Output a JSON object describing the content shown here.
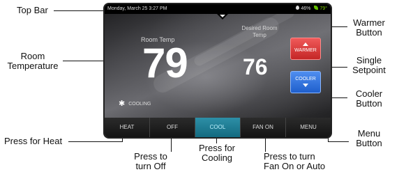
{
  "callouts": {
    "top_bar": "Top Bar",
    "room_temperature_line1": "Room",
    "room_temperature_line2": "Temperature",
    "press_for_heat": "Press for Heat",
    "press_to_turn_off_line1": "Press to",
    "press_to_turn_off_line2": "turn Off",
    "press_for_cooling_line1": "Press for",
    "press_for_cooling_line2": "Cooling",
    "press_fan_line1": "Press to turn",
    "press_fan_line2": "Fan On or Auto",
    "warmer_button_line1": "Warmer",
    "warmer_button_line2": "Button",
    "single_setpoint_line1": "Single",
    "single_setpoint_line2": "Setpoint",
    "cooler_button_line1": "Cooler",
    "cooler_button_line2": "Button",
    "menu_button_line1": "Menu",
    "menu_button_line2": "Button"
  },
  "screen": {
    "topbar": {
      "datetime": "Monday, March 25 3:27 PM",
      "humidity": "46%",
      "outdoor_temp": "79°"
    },
    "room_temp_label": "Room Temp",
    "room_temp": "79",
    "setpoint_label": "Desired Room Temp",
    "setpoint": "76",
    "warmer_label": "WARMER",
    "cooler_label": "COOLER",
    "mode_status": "COOLING",
    "buttons": [
      {
        "label": "HEAT",
        "active": false
      },
      {
        "label": "OFF",
        "active": false
      },
      {
        "label": "COOL",
        "active": true
      },
      {
        "label": "FAN ON",
        "active": false
      },
      {
        "label": "MENU",
        "active": false
      }
    ]
  },
  "colors": {
    "warmer": "#d93a3a",
    "cooler": "#2f74de",
    "active_mode": "#1f7f97",
    "outdoor_temp": "#7fd000"
  }
}
